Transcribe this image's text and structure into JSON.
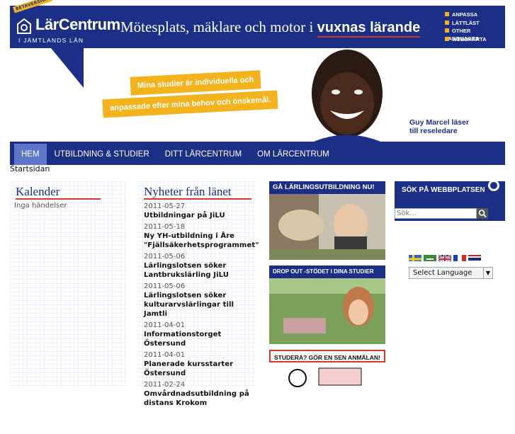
{
  "header": {
    "badge": "BETAVERSION",
    "logo_name": "LärCentrum",
    "logo_sub": "I JÄMTLANDS LÄN",
    "tagline_plain": "Mötesplats, mäklare och motor i",
    "tagline_bold": "vuxnas lärande",
    "toplinks": [
      "ANPASSA",
      "LÄTTLÄST",
      "OTHER LANGUAGES",
      "WEBBKARTA"
    ]
  },
  "banner": {
    "pill1": "Mina studier är individuella och",
    "pill2": "anpassade efter mina behov och önskemål.",
    "caption_line1": "Guy Marcel läser",
    "caption_line2": "till reseledare"
  },
  "nav": {
    "items": [
      "HEM",
      "UTBILDNING & STUDIER",
      "DITT LÄRCENTRUM",
      "OM LÄRCENTRUM"
    ],
    "active": 0
  },
  "breadcrumb": "Startsidan",
  "calendar": {
    "title": "Kalender",
    "empty": "Inga händelser"
  },
  "news": {
    "title": "Nyheter från länet",
    "items": [
      {
        "date": "2011-05-27",
        "title": "Utbildningar på JiLU"
      },
      {
        "date": "2011-05-18",
        "title": "Ny YH-utbildning i Åre \"Fjällsäkerhetsprogrammet\""
      },
      {
        "date": "2011-05-06",
        "title": "Lärlingslotsen söker Lantbrukslärling JiLU"
      },
      {
        "date": "2011-05-06",
        "title": "Lärlingslotsen söker kulturarvslärlingar till Jamtli"
      },
      {
        "date": "2011-04-01",
        "title": "Informationstorget Östersund"
      },
      {
        "date": "2011-04-01",
        "title": "Planerade kursstarter Östersund"
      },
      {
        "date": "2011-02-24",
        "title": "Omvårdnadsutbildning på distans Krokom"
      }
    ]
  },
  "ads": [
    {
      "label": "GÅ LÄRLINGSUTBILDNING NU!"
    },
    {
      "label": "DROP OUT -STÖDET I DINA STUDIER"
    },
    {
      "label": "STUDERA? GÖR EN SEN ANMÄLAN!"
    }
  ],
  "search": {
    "title": "SÖK PÅ WEBBPLATSEN",
    "placeholder": "Sök..."
  },
  "language": {
    "selected": "Select Language",
    "flags": [
      "swedish-flag",
      "arabic-flag",
      "english-flag",
      "french-flag",
      "thai-flag"
    ]
  },
  "colors": {
    "brand_blue": "#1b2f86",
    "accent_yellow": "#f2b31c",
    "accent_red": "#d43a2a",
    "nav_active": "#5d76c9"
  }
}
